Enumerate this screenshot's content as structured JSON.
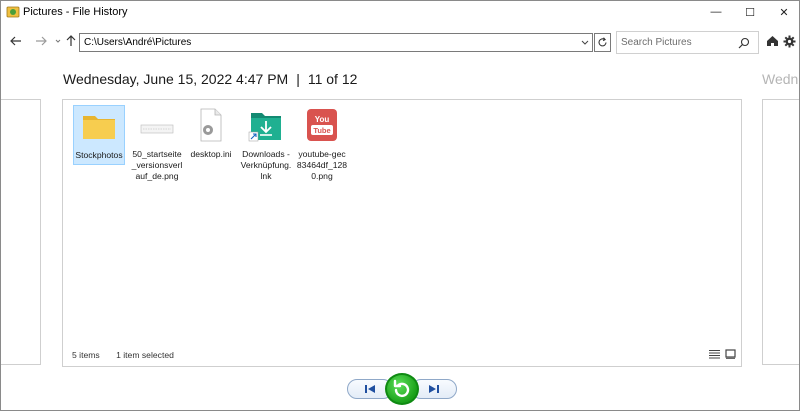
{
  "window": {
    "title": "Pictures - File History",
    "controls": {
      "minimize": "—",
      "maximize": "☐",
      "close": "✕"
    }
  },
  "navigation": {
    "back_icon": "arrow-left-icon",
    "forward_icon": "arrow-right-icon",
    "recent_icon": "chevron-down-icon",
    "up_icon": "arrow-up-icon",
    "address": "C:\\Users\\André\\Pictures",
    "search_placeholder": "Search Pictures",
    "home_icon": "home-icon",
    "settings_icon": "gear-icon"
  },
  "snapshot": {
    "date_time": "Wednesday, June 15, 2022 4:47 PM",
    "separator": "|",
    "position": "11 of 12",
    "next_peek": "Wedne"
  },
  "files": [
    {
      "name": "Stockphotos",
      "icon": "folder-icon",
      "selected": true
    },
    {
      "name": "50_startseite_versionsverlauf_de.png",
      "icon": "image-thumbnail-icon",
      "selected": false
    },
    {
      "name": "desktop.ini",
      "icon": "settings-file-icon",
      "selected": false
    },
    {
      "name": "Downloads - Verknüpfung.lnk",
      "icon": "downloads-shortcut-icon",
      "selected": false
    },
    {
      "name": "youtube-gec83464df_1280.png",
      "icon": "youtube-icon",
      "selected": false
    }
  ],
  "status": {
    "items_count": "5 items",
    "selection": "1 item selected"
  },
  "colors": {
    "selection_bg": "#cce8ff",
    "restore_green": "#1aa11a",
    "folder_yellow": "#f5c542",
    "youtube_red": "#e02424"
  }
}
